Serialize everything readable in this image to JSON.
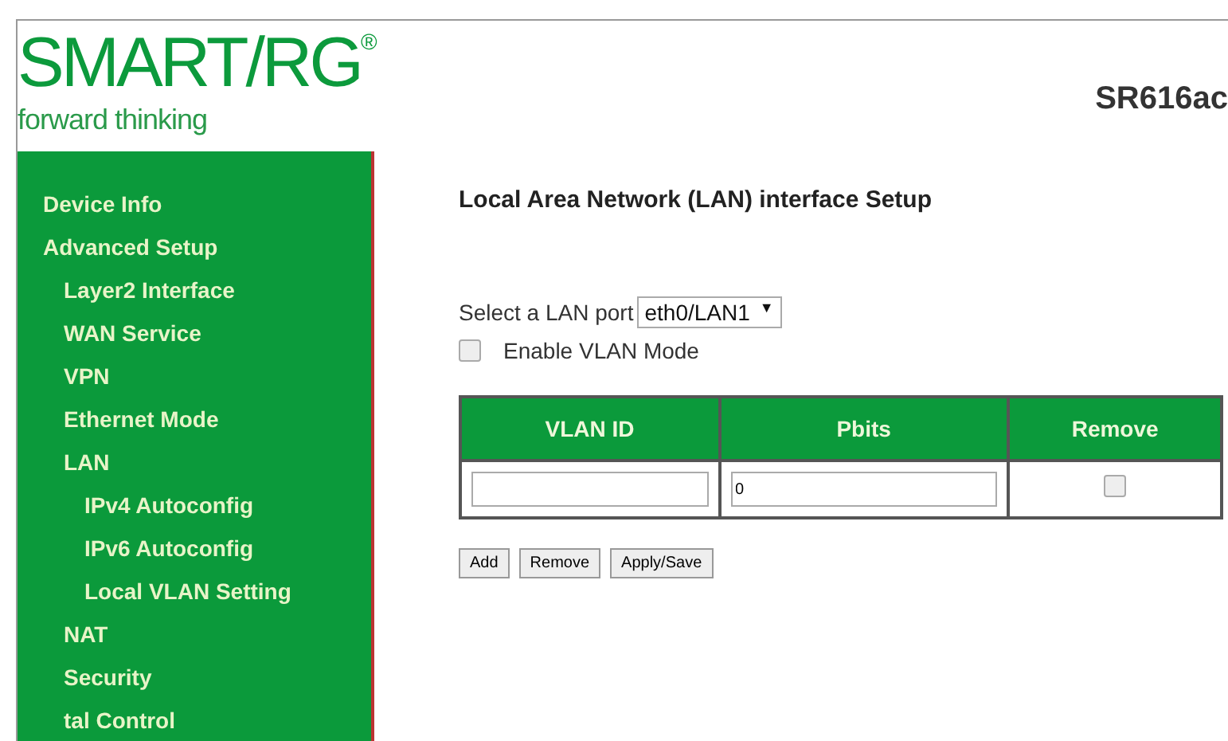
{
  "logo": {
    "brand": "SMART/RG",
    "mark": "®",
    "tagline": "forward thinking"
  },
  "model": "SR616ac",
  "sidebar": {
    "items": [
      {
        "label": "Device Info"
      },
      {
        "label": "Advanced Setup",
        "children": [
          {
            "label": "Layer2 Interface"
          },
          {
            "label": "WAN Service"
          },
          {
            "label": "VPN"
          },
          {
            "label": "Ethernet Mode"
          },
          {
            "label": "LAN",
            "children": [
              {
                "label": "IPv4 Autoconfig"
              },
              {
                "label": "IPv6 Autoconfig"
              },
              {
                "label": "Local VLAN Setting"
              }
            ]
          },
          {
            "label": "NAT"
          },
          {
            "label": "Security"
          },
          {
            "label": "tal Control"
          }
        ]
      }
    ]
  },
  "content": {
    "title": "Local Area Network (LAN) interface Setup",
    "port_select": {
      "label": "Select a LAN port",
      "value": "eth0/LAN1",
      "caret": "▼"
    },
    "vlan_mode": {
      "label": "Enable VLAN Mode",
      "checked": false
    },
    "table": {
      "columns": [
        "VLAN ID",
        "Pbits",
        "Remove"
      ],
      "rows": [
        {
          "pbits": "0",
          "remove": false
        }
      ]
    },
    "buttons": [
      "Add",
      "Remove",
      "Apply/Save"
    ]
  }
}
